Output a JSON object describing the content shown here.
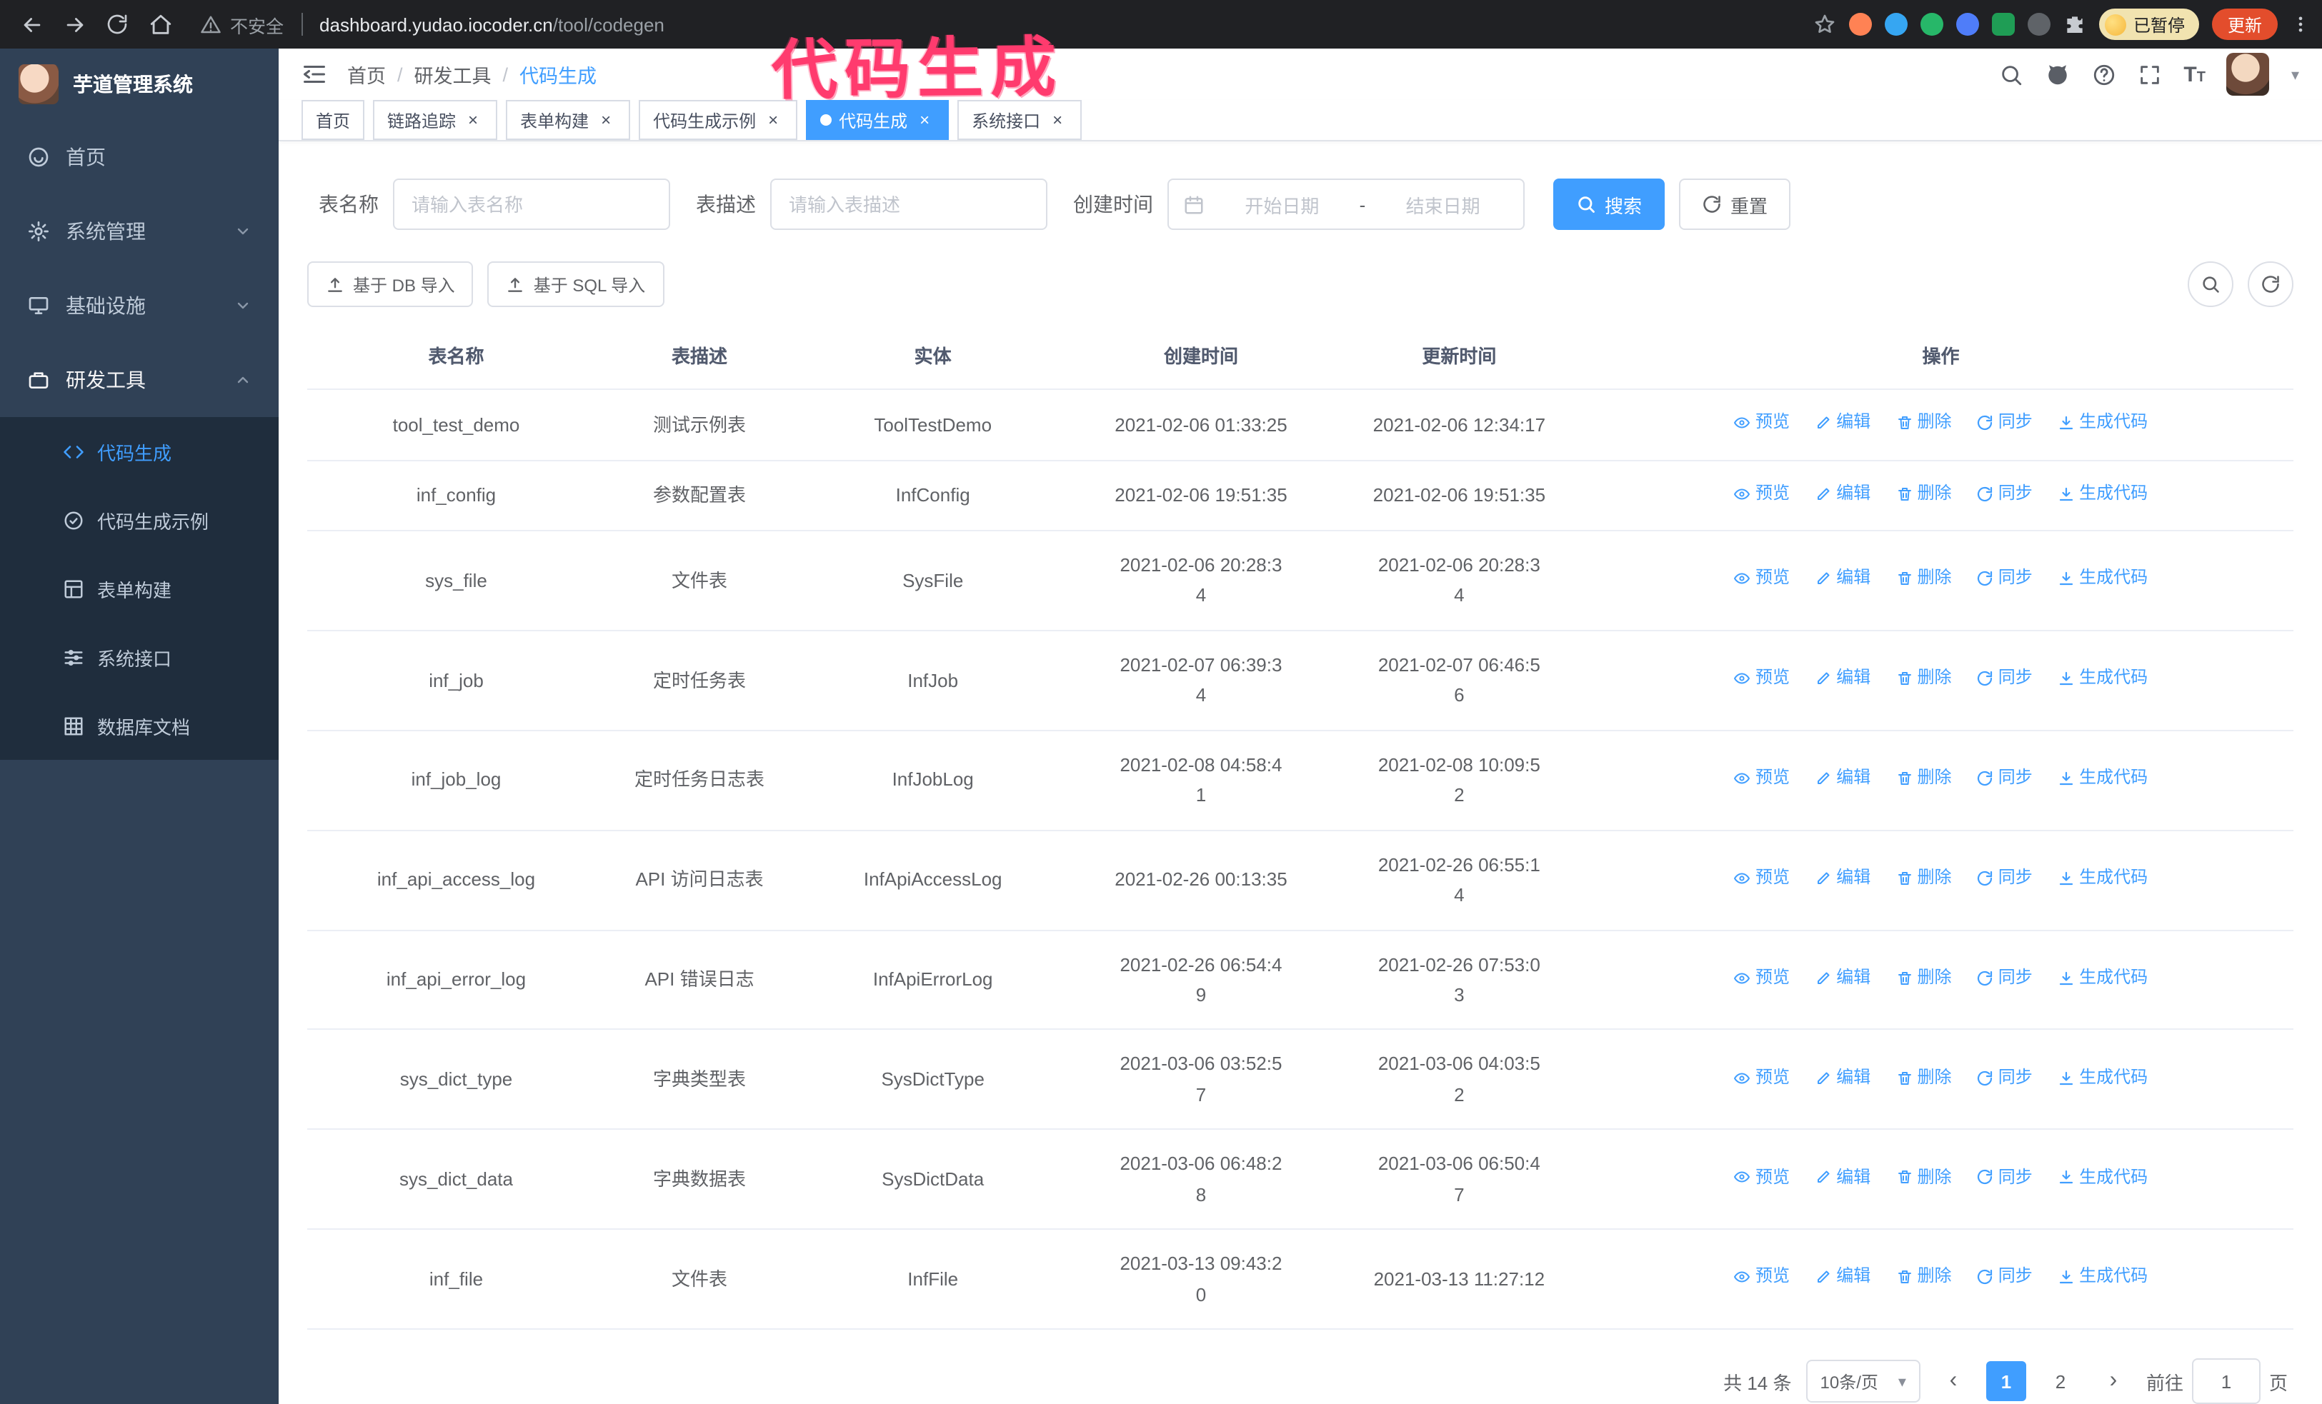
{
  "annotation": {
    "text": "代码生成"
  },
  "icons": {
    "close": "×",
    "caret_down": "▾",
    "breadcrumb_sep": "/",
    "prev": "‹",
    "next": "›"
  },
  "browser": {
    "insecure_label": "不安全",
    "url_host": "dashboard.yudao.iocoder.cn",
    "url_path": "/tool/codegen",
    "paused_badge": "已暂停",
    "update_button": "更新"
  },
  "sidebar": {
    "title": "芋道管理系统",
    "items": [
      {
        "label": "首页"
      },
      {
        "label": "系统管理"
      },
      {
        "label": "基础设施"
      },
      {
        "label": "研发工具"
      }
    ],
    "sub_items": [
      {
        "label": "代码生成"
      },
      {
        "label": "代码生成示例"
      },
      {
        "label": "表单构建"
      },
      {
        "label": "系统接口"
      },
      {
        "label": "数据库文档"
      }
    ]
  },
  "header": {
    "breadcrumb": [
      "首页",
      "研发工具",
      "代码生成"
    ]
  },
  "tabs": [
    {
      "label": "首页"
    },
    {
      "label": "链路追踪"
    },
    {
      "label": "表单构建"
    },
    {
      "label": "代码生成示例"
    },
    {
      "label": "代码生成"
    },
    {
      "label": "系统接口"
    }
  ],
  "filters": {
    "name_label": "表名称",
    "name_placeholder": "请输入表名称",
    "desc_label": "表描述",
    "desc_placeholder": "请输入表描述",
    "time_label": "创建时间",
    "start_placeholder": "开始日期",
    "range_separator": "-",
    "end_placeholder": "结束日期",
    "search_button": "搜索",
    "reset_button": "重置"
  },
  "toolbar": {
    "import_db": "基于 DB 导入",
    "import_sql": "基于 SQL 导入"
  },
  "table": {
    "columns": [
      "表名称",
      "表描述",
      "实体",
      "创建时间",
      "更新时间",
      "操作"
    ],
    "actions": [
      "预览",
      "编辑",
      "删除",
      "同步",
      "生成代码"
    ],
    "rows": [
      {
        "name": "tool_test_demo",
        "desc": "测试示例表",
        "entity": "ToolTestDemo",
        "created": "2021-02-06 01:33:25",
        "updated": "2021-02-06 12:34:17"
      },
      {
        "name": "inf_config",
        "desc": "参数配置表",
        "entity": "InfConfig",
        "created": "2021-02-06 19:51:35",
        "updated": "2021-02-06 19:51:35"
      },
      {
        "name": "sys_file",
        "desc": "文件表",
        "entity": "SysFile",
        "created": "2021-02-06 20:28:3\n4",
        "updated": "2021-02-06 20:28:3\n4"
      },
      {
        "name": "inf_job",
        "desc": "定时任务表",
        "entity": "InfJob",
        "created": "2021-02-07 06:39:3\n4",
        "updated": "2021-02-07 06:46:5\n6"
      },
      {
        "name": "inf_job_log",
        "desc": "定时任务日志表",
        "entity": "InfJobLog",
        "created": "2021-02-08 04:58:4\n1",
        "updated": "2021-02-08 10:09:5\n2"
      },
      {
        "name": "inf_api_access_log",
        "desc": "API 访问日志表",
        "entity": "InfApiAccessLog",
        "created": "2021-02-26 00:13:35",
        "updated": "2021-02-26 06:55:1\n4"
      },
      {
        "name": "inf_api_error_log",
        "desc": "API 错误日志",
        "entity": "InfApiErrorLog",
        "created": "2021-02-26 06:54:4\n9",
        "updated": "2021-02-26 07:53:0\n3"
      },
      {
        "name": "sys_dict_type",
        "desc": "字典类型表",
        "entity": "SysDictType",
        "created": "2021-03-06 03:52:5\n7",
        "updated": "2021-03-06 04:03:5\n2"
      },
      {
        "name": "sys_dict_data",
        "desc": "字典数据表",
        "entity": "SysDictData",
        "created": "2021-03-06 06:48:2\n8",
        "updated": "2021-03-06 06:50:4\n7"
      },
      {
        "name": "inf_file",
        "desc": "文件表",
        "entity": "InfFile",
        "created": "2021-03-13 09:43:2\n0",
        "updated": "2021-03-13 11:27:12"
      }
    ]
  },
  "pagination": {
    "total": "共 14 条",
    "page_size": "10条/页",
    "pages": [
      "1",
      "2"
    ],
    "goto_label": "前往",
    "goto_value": "1",
    "goto_suffix": "页"
  }
}
